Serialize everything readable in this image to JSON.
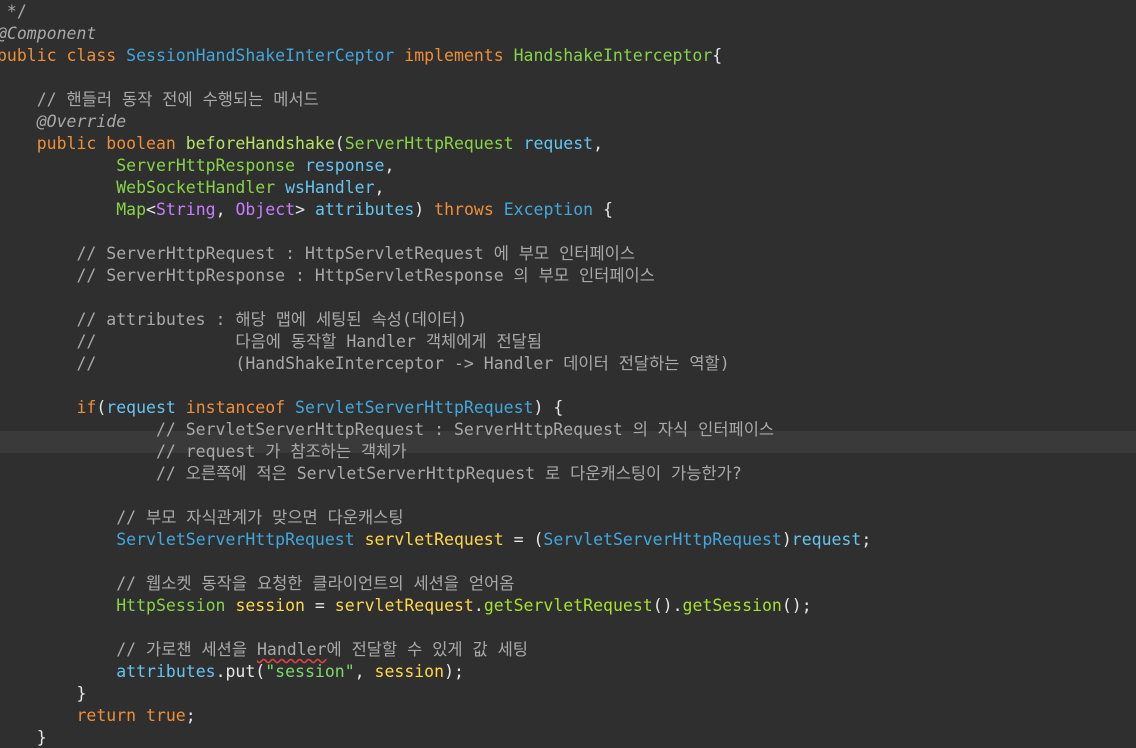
{
  "colors": {
    "background": "#2f2f2f",
    "current_line": "#3a3a3a",
    "keyword": "#ee8f3a",
    "type": "#42a7db",
    "class_name": "#87d34a",
    "method": "#b7e266",
    "parameter": "#66c4ef",
    "variable": "#ffd84a",
    "comment": "#a9a9a9",
    "string": "#7ed86b",
    "generic_type": "#c77dff",
    "plain": "#e6e6e6"
  },
  "lines": [
    [
      {
        "t": " */",
        "c": "comment"
      }
    ],
    [
      {
        "t": "@Component",
        "c": "anno"
      }
    ],
    [
      {
        "t": "public class ",
        "c": "kw"
      },
      {
        "t": "SessionHandShakeInterCeptor",
        "c": "type"
      },
      {
        "t": " implements ",
        "c": "kw"
      },
      {
        "t": "HandshakeInterceptor",
        "c": "cls"
      },
      {
        "t": "{",
        "c": "plain"
      }
    ],
    [],
    [
      {
        "t": "    // 핸들러 동작 전에 수행되는 메서드",
        "c": "comment"
      }
    ],
    [
      {
        "t": "    @Override",
        "c": "anno"
      }
    ],
    [
      {
        "t": "    public boolean ",
        "c": "kw"
      },
      {
        "t": "beforeHandshake",
        "c": "method"
      },
      {
        "t": "(",
        "c": "plain"
      },
      {
        "t": "ServerHttpRequest",
        "c": "cls"
      },
      {
        "t": " ",
        "c": "plain"
      },
      {
        "t": "request",
        "c": "param"
      },
      {
        "t": ",",
        "c": "plain"
      }
    ],
    [
      {
        "t": "            ",
        "c": "plain"
      },
      {
        "t": "ServerHttpResponse",
        "c": "cls"
      },
      {
        "t": " ",
        "c": "plain"
      },
      {
        "t": "response",
        "c": "param"
      },
      {
        "t": ",",
        "c": "plain"
      }
    ],
    [
      {
        "t": "            ",
        "c": "plain"
      },
      {
        "t": "WebSocketHandler",
        "c": "cls"
      },
      {
        "t": " ",
        "c": "plain"
      },
      {
        "t": "wsHandler",
        "c": "param"
      },
      {
        "t": ",",
        "c": "plain"
      }
    ],
    [
      {
        "t": "            ",
        "c": "plain"
      },
      {
        "t": "Map",
        "c": "cls"
      },
      {
        "t": "<",
        "c": "plain"
      },
      {
        "t": "String",
        "c": "purple"
      },
      {
        "t": ", ",
        "c": "plain"
      },
      {
        "t": "Object",
        "c": "purple"
      },
      {
        "t": "> ",
        "c": "plain"
      },
      {
        "t": "attributes",
        "c": "param"
      },
      {
        "t": ") ",
        "c": "plain"
      },
      {
        "t": "throws ",
        "c": "kw"
      },
      {
        "t": "Exception",
        "c": "type"
      },
      {
        "t": " {",
        "c": "plain"
      }
    ],
    [],
    [
      {
        "t": "        // ServerHttpRequest : HttpServletRequest 에 부모 인터페이스",
        "c": "comment"
      }
    ],
    [
      {
        "t": "        // ServerHttpResponse : HttpServletResponse 의 부모 인터페이스",
        "c": "comment"
      }
    ],
    [],
    [
      {
        "t": "        // attributes : 해당 맵에 세팅된 속성(데이터)",
        "c": "comment"
      }
    ],
    [
      {
        "t": "        //              다음에 동작할 Handler 객체에게 전달됨",
        "c": "comment"
      }
    ],
    [
      {
        "t": "        //              (HandShakeInterceptor -> Handler 데이터 전달하는 역할)",
        "c": "comment"
      }
    ],
    [],
    [
      {
        "t": "        if",
        "c": "kw"
      },
      {
        "t": "(",
        "c": "plain"
      },
      {
        "t": "request",
        "c": "param"
      },
      {
        "t": " instanceof ",
        "c": "kw"
      },
      {
        "t": "ServletServerHttpRequest",
        "c": "type"
      },
      {
        "t": ") {",
        "c": "plain"
      }
    ],
    [
      {
        "t": "                // ServletServerHttpRequest : ServerHttpRequest 의 자식 인터페이스",
        "c": "comment"
      }
    ],
    [
      {
        "t": "                // request 가 참조하는 객체가",
        "c": "comment"
      }
    ],
    [
      {
        "t": "                // 오른쪽에 적은 ServletServerHttpRequest 로 다운캐스팅이 가능한가?",
        "c": "comment"
      }
    ],
    [],
    [
      {
        "t": "            // 부모 자식관계가 맞으면 다운캐스팅",
        "c": "comment"
      }
    ],
    [
      {
        "t": "            ",
        "c": "plain"
      },
      {
        "t": "ServletServerHttpRequest",
        "c": "type"
      },
      {
        "t": " ",
        "c": "plain"
      },
      {
        "t": "servletRequest",
        "c": "var"
      },
      {
        "t": " = (",
        "c": "plain"
      },
      {
        "t": "ServletServerHttpRequest",
        "c": "type"
      },
      {
        "t": ")",
        "c": "plain"
      },
      {
        "t": "request",
        "c": "param"
      },
      {
        "t": ";",
        "c": "plain"
      }
    ],
    [],
    [
      {
        "t": "            // 웹소켓 동작을 요청한 클라이언트의 세션을 얻어옴",
        "c": "comment"
      }
    ],
    [
      {
        "t": "            ",
        "c": "plain"
      },
      {
        "t": "HttpSession",
        "c": "cls"
      },
      {
        "t": " ",
        "c": "plain"
      },
      {
        "t": "session",
        "c": "var"
      },
      {
        "t": " = ",
        "c": "plain"
      },
      {
        "t": "servletRequest",
        "c": "var"
      },
      {
        "t": ".",
        "c": "plain"
      },
      {
        "t": "getServletRequest",
        "c": "method2"
      },
      {
        "t": "().",
        "c": "plain"
      },
      {
        "t": "getSession",
        "c": "method2"
      },
      {
        "t": "();",
        "c": "plain"
      }
    ],
    [],
    [
      {
        "t": "            // 가로챈 세션을 ",
        "c": "comment"
      },
      {
        "t": "Handler",
        "c": "comment",
        "squiggle": true
      },
      {
        "t": "에 전달할 수 있게 값 세팅",
        "c": "comment"
      }
    ],
    [
      {
        "t": "            ",
        "c": "plain"
      },
      {
        "t": "attributes",
        "c": "param"
      },
      {
        "t": ".put(",
        "c": "plain"
      },
      {
        "t": "\"session\"",
        "c": "string"
      },
      {
        "t": ", ",
        "c": "plain"
      },
      {
        "t": "session",
        "c": "var"
      },
      {
        "t": ");",
        "c": "plain"
      }
    ],
    [
      {
        "t": "        }",
        "c": "plain"
      }
    ],
    [
      {
        "t": "        return true",
        "c": "kw"
      },
      {
        "t": ";",
        "c": "plain"
      }
    ],
    [
      {
        "t": "    }",
        "c": "plain"
      }
    ]
  ]
}
